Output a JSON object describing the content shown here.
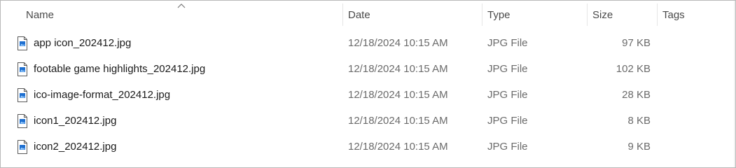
{
  "columns": {
    "name": "Name",
    "date": "Date",
    "type": "Type",
    "size": "Size",
    "tags": "Tags",
    "sort_indicator": "chevron-up-icon"
  },
  "files": [
    {
      "name": "app icon_202412.jpg",
      "date": "12/18/2024 10:15 AM",
      "type": "JPG File",
      "size": "97 KB",
      "icon": "jpg-file-icon"
    },
    {
      "name": "footable game highlights_202412.jpg",
      "date": "12/18/2024 10:15 AM",
      "type": "JPG File",
      "size": "102 KB",
      "icon": "jpg-file-icon"
    },
    {
      "name": "ico-image-format_202412.jpg",
      "date": "12/18/2024 10:15 AM",
      "type": "JPG File",
      "size": "28 KB",
      "icon": "jpg-file-icon"
    },
    {
      "name": "icon1_202412.jpg",
      "date": "12/18/2024 10:15 AM",
      "type": "JPG File",
      "size": "8 KB",
      "icon": "jpg-file-icon"
    },
    {
      "name": "icon2_202412.jpg",
      "date": "12/18/2024 10:15 AM",
      "type": "JPG File",
      "size": "9 KB",
      "icon": "jpg-file-icon"
    }
  ],
  "colors": {
    "header_text": "#4a4a4a",
    "name_text": "#1a1a1a",
    "detail_text": "#6b6b6b",
    "icon_blue": "#1e6fd0"
  }
}
